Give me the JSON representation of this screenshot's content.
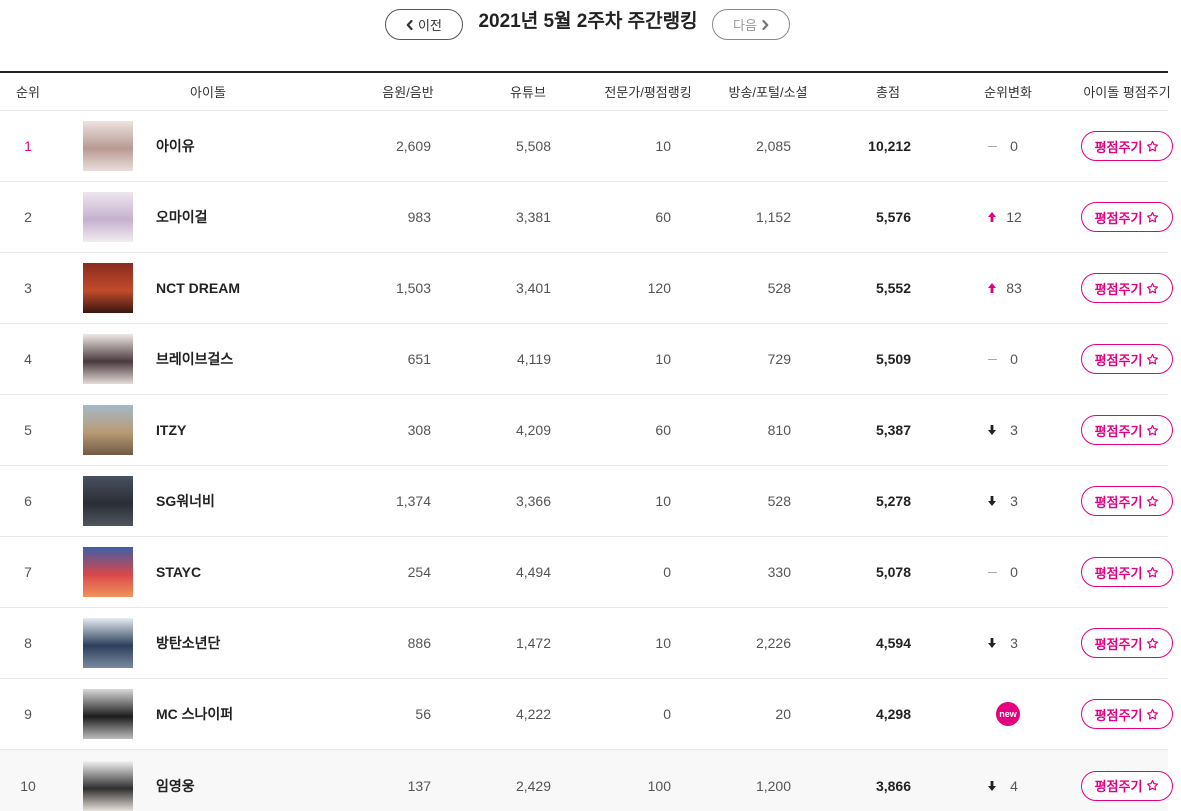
{
  "header": {
    "prev_label": "이전",
    "next_label": "다음",
    "title": "2021년 5월 2주차 주간랭킹"
  },
  "columns": {
    "rank": "순위",
    "idol": "아이돌",
    "music": "음원/음반",
    "youtube": "유튜브",
    "expert": "전문가/평점랭킹",
    "broadcast": "방송/포털/소셜",
    "total": "총점",
    "change": "순위변화",
    "rate": "아이돌 평점주기"
  },
  "labels": {
    "rate_button": "평점주기",
    "new_badge": "new"
  },
  "colors": {
    "accent": "#e4007f",
    "rule": "#222222",
    "divider": "#e9e9e9",
    "down": "#222222",
    "dash": "#aaaaaa",
    "hover": "#f8f8f8"
  },
  "rows": [
    {
      "rank": "1",
      "name": "아이유",
      "music": "2,609",
      "youtube": "5,508",
      "expert": "10",
      "broadcast": "2,085",
      "total": "10,212",
      "change_dir": "same",
      "change": "0",
      "photo_colors": [
        "#ece2df",
        "#b99a93",
        "#e9dfdc"
      ]
    },
    {
      "rank": "2",
      "name": "오마이걸",
      "music": "983",
      "youtube": "3,381",
      "expert": "60",
      "broadcast": "1,152",
      "total": "5,576",
      "change_dir": "up",
      "change": "12",
      "photo_colors": [
        "#eee6ee",
        "#c6b0cf",
        "#f2edf0"
      ]
    },
    {
      "rank": "3",
      "name": "NCT DREAM",
      "music": "1,503",
      "youtube": "3,401",
      "expert": "120",
      "broadcast": "528",
      "total": "5,552",
      "change_dir": "up",
      "change": "83",
      "photo_colors": [
        "#8a2a1e",
        "#c24b2b",
        "#3a1510"
      ]
    },
    {
      "rank": "4",
      "name": "브레이브걸스",
      "music": "651",
      "youtube": "4,119",
      "expert": "10",
      "broadcast": "729",
      "total": "5,509",
      "change_dir": "same",
      "change": "0",
      "photo_colors": [
        "#efe9e6",
        "#4a3a3f",
        "#e4dbd7"
      ]
    },
    {
      "rank": "5",
      "name": "ITZY",
      "music": "308",
      "youtube": "4,209",
      "expert": "60",
      "broadcast": "810",
      "total": "5,387",
      "change_dir": "down",
      "change": "3",
      "photo_colors": [
        "#a3b9c8",
        "#b89b74",
        "#6f5a44"
      ]
    },
    {
      "rank": "6",
      "name": "SG워너비",
      "music": "1,374",
      "youtube": "3,366",
      "expert": "10",
      "broadcast": "528",
      "total": "5,278",
      "change_dir": "down",
      "change": "3",
      "photo_colors": [
        "#4a5260",
        "#2a2d35",
        "#50555f"
      ]
    },
    {
      "rank": "7",
      "name": "STAYC",
      "music": "254",
      "youtube": "4,494",
      "expert": "0",
      "broadcast": "330",
      "total": "5,078",
      "change_dir": "same",
      "change": "0",
      "photo_colors": [
        "#3c5fa8",
        "#d9474a",
        "#f0955a"
      ]
    },
    {
      "rank": "8",
      "name": "방탄소년단",
      "music": "886",
      "youtube": "1,472",
      "expert": "10",
      "broadcast": "2,226",
      "total": "4,594",
      "change_dir": "down",
      "change": "3",
      "photo_colors": [
        "#e6ecf1",
        "#2b3f5c",
        "#7a8ba0"
      ]
    },
    {
      "rank": "9",
      "name": "MC 스나이퍼",
      "music": "56",
      "youtube": "4,222",
      "expert": "0",
      "broadcast": "20",
      "total": "4,298",
      "change_dir": "new",
      "photo_colors": [
        "#d9d9d9",
        "#1c1c1c",
        "#bdbdbd"
      ]
    },
    {
      "rank": "10",
      "name": "임영웅",
      "music": "137",
      "youtube": "2,429",
      "expert": "100",
      "broadcast": "1,200",
      "total": "3,866",
      "change_dir": "down",
      "change": "4",
      "photo_colors": [
        "#f3f3f3",
        "#2f2f2f",
        "#e8e2dc"
      ]
    }
  ]
}
